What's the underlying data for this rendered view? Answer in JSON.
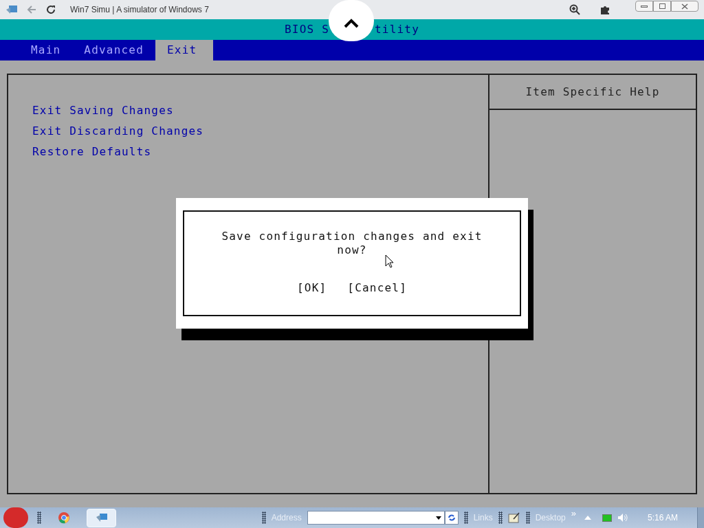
{
  "browser": {
    "title": "Win7 Simu | A simulator of Windows 7"
  },
  "bios": {
    "title_left": "BIOS S",
    "title_right": "tility",
    "tabs": [
      {
        "label": "Main",
        "selected": false
      },
      {
        "label": "Advanced",
        "selected": false
      },
      {
        "label": "Exit",
        "selected": true
      }
    ],
    "items": [
      "Exit Saving Changes",
      "Exit Discarding Changes",
      "Restore Defaults"
    ],
    "help_title": "Item Specific Help",
    "dialog": {
      "message": "Save configuration changes and exit now?",
      "buttons": [
        "[OK]",
        "[Cancel]"
      ]
    }
  },
  "taskbar": {
    "address_label": "Address",
    "links": "Links",
    "desktop": "Desktop",
    "more": "»",
    "time": "5:16 AM"
  }
}
